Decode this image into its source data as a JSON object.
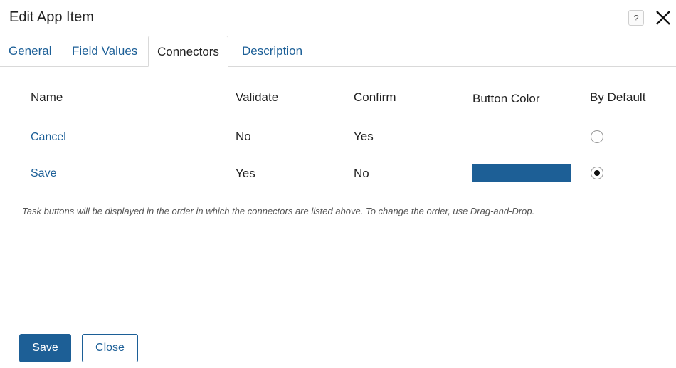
{
  "dialog": {
    "title": "Edit App Item",
    "help_icon": "help-icon",
    "close_icon": "close-icon"
  },
  "tabs": [
    {
      "label": "General",
      "active": false
    },
    {
      "label": "Field Values",
      "active": false
    },
    {
      "label": "Connectors",
      "active": true
    },
    {
      "label": "Description",
      "active": false
    }
  ],
  "table": {
    "headers": [
      "Name",
      "Validate",
      "Confirm",
      "Button Color",
      "By Default"
    ],
    "rows": [
      {
        "name": "Cancel",
        "validate": "No",
        "confirm": "Yes",
        "button_color": "",
        "by_default": false
      },
      {
        "name": "Save",
        "validate": "Yes",
        "confirm": "No",
        "button_color": "#1d5f96",
        "by_default": true
      }
    ]
  },
  "hint": "Task buttons will be displayed in the order in which the connectors are listed above. To change the order, use Drag-and-Drop.",
  "footer": {
    "save_label": "Save",
    "close_label": "Close"
  },
  "colors": {
    "accent": "#1d5f96",
    "link": "#1c5f97"
  }
}
